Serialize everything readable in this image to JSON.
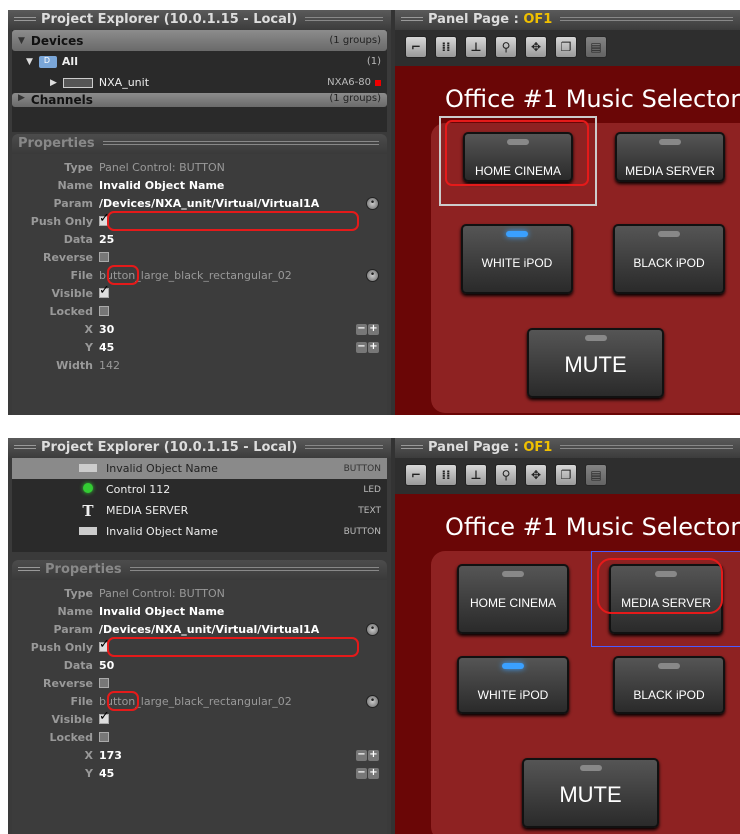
{
  "shot1": {
    "project_title": "Project Explorer (10.0.1.15 - Local)",
    "tree": {
      "devices": {
        "label": "Devices",
        "meta": "(1 groups)"
      },
      "all": {
        "label": "All",
        "meta": "(1)"
      },
      "unit": {
        "label": "NXA_unit",
        "meta": "NXA6-80"
      },
      "channels": {
        "label": "Channels",
        "meta": "(1 groups)"
      }
    },
    "properties": {
      "title": "Properties",
      "type": "Panel Control: BUTTON",
      "name": "Invalid Object Name",
      "param": "/Devices/NXA_unit/Virtual/Virtual1A",
      "data": "25",
      "file": "button_large_black_rectangular_02",
      "x": "30",
      "y": "45",
      "width": "142"
    },
    "panel_page_label": "Panel Page :",
    "panel_page_value": "OF1"
  },
  "shot2": {
    "project_title": "Project Explorer (10.0.1.15 - Local)",
    "objects": [
      {
        "label": "Invalid Object Name",
        "meta": "BUTTON",
        "icon": "button-icon"
      },
      {
        "label": "Control 112",
        "meta": "LED",
        "icon": "led-icon"
      },
      {
        "label": "MEDIA SERVER",
        "meta": "TEXT",
        "icon": "text-icon"
      },
      {
        "label": "Invalid Object Name",
        "meta": "BUTTON",
        "icon": "button-icon"
      }
    ],
    "properties": {
      "title": "Properties",
      "type": "Panel Control: BUTTON",
      "name": "Invalid Object Name",
      "param": "/Devices/NXA_unit/Virtual/Virtual1A",
      "data": "50",
      "file": "button_large_black_rectangular_02",
      "x": "173",
      "y": "45"
    },
    "panel_page_label": "Panel Page :",
    "panel_page_value": "OF1"
  },
  "labels": {
    "type": "Type",
    "name": "Name",
    "param": "Param",
    "push_only": "Push Only",
    "data": "Data",
    "reverse": "Reverse",
    "file": "File",
    "visible": "Visible",
    "locked": "Locked",
    "x": "X",
    "y": "Y",
    "width": "Width"
  },
  "panel": {
    "title": "Office #1 Music Selector",
    "buttons": {
      "home_cinema": "HOME CINEMA",
      "media_server": "MEDIA SERVER",
      "white_ipod": "WHITE iPOD",
      "black_ipod": "BLACK iPOD",
      "mute": "MUTE"
    }
  },
  "colors": {
    "highlight": "#e51a1a",
    "panel_bg": "#6a0606",
    "page_accent": "#f0c000"
  }
}
